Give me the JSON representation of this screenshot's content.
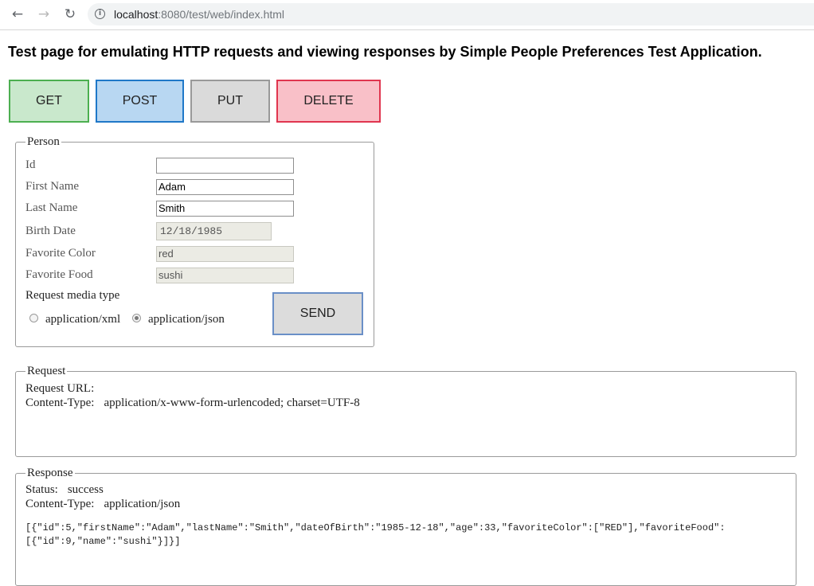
{
  "browser": {
    "url_host": "localhost",
    "url_rest": ":8080/test/web/index.html",
    "back_icon": "back-arrow-icon",
    "forward_icon": "forward-arrow-icon",
    "reload_icon": "reload-icon"
  },
  "page": {
    "title": "Test page for emulating HTTP requests and viewing responses by Simple People Preferences Test Application."
  },
  "methods": {
    "get": "GET",
    "post": "POST",
    "put": "PUT",
    "delete": "DELETE"
  },
  "person": {
    "legend": "Person",
    "id_label": "Id",
    "id_value": "",
    "first_name_label": "First Name",
    "first_name_value": "Adam",
    "last_name_label": "Last Name",
    "last_name_value": "Smith",
    "birth_date_label": "Birth Date",
    "birth_date_value": "12/18/1985",
    "favorite_color_label": "Favorite Color",
    "favorite_color_value": "red",
    "favorite_food_label": "Favorite Food",
    "favorite_food_value": "sushi",
    "media_type_label": "Request media type",
    "media_options": [
      "application/xml",
      "application/json"
    ],
    "media_selected": "application/json",
    "send_label": "SEND"
  },
  "request": {
    "legend": "Request",
    "url_key": "Request URL:",
    "url_value": "",
    "content_type_key": "Content-Type:",
    "content_type_value": "application/x-www-form-urlencoded; charset=UTF-8"
  },
  "response": {
    "legend": "Response",
    "status_key": "Status:",
    "status_value": "success",
    "content_type_key": "Content-Type:",
    "content_type_value": "application/json",
    "body": "[{\"id\":5,\"firstName\":\"Adam\",\"lastName\":\"Smith\",\"dateOfBirth\":\"1985-12-18\",\"age\":33,\"favoriteColor\":[\"RED\"],\"favoriteFood\":\n[{\"id\":9,\"name\":\"sushi\"}]}]"
  },
  "colors": {
    "get_bg": "#c9e8cc",
    "get_border": "#4caf50",
    "post_bg": "#b8d7f2",
    "post_border": "#1f78c8",
    "put_bg": "#dadada",
    "put_border": "#999999",
    "delete_bg": "#f9c0c8",
    "delete_border": "#e0354f"
  }
}
